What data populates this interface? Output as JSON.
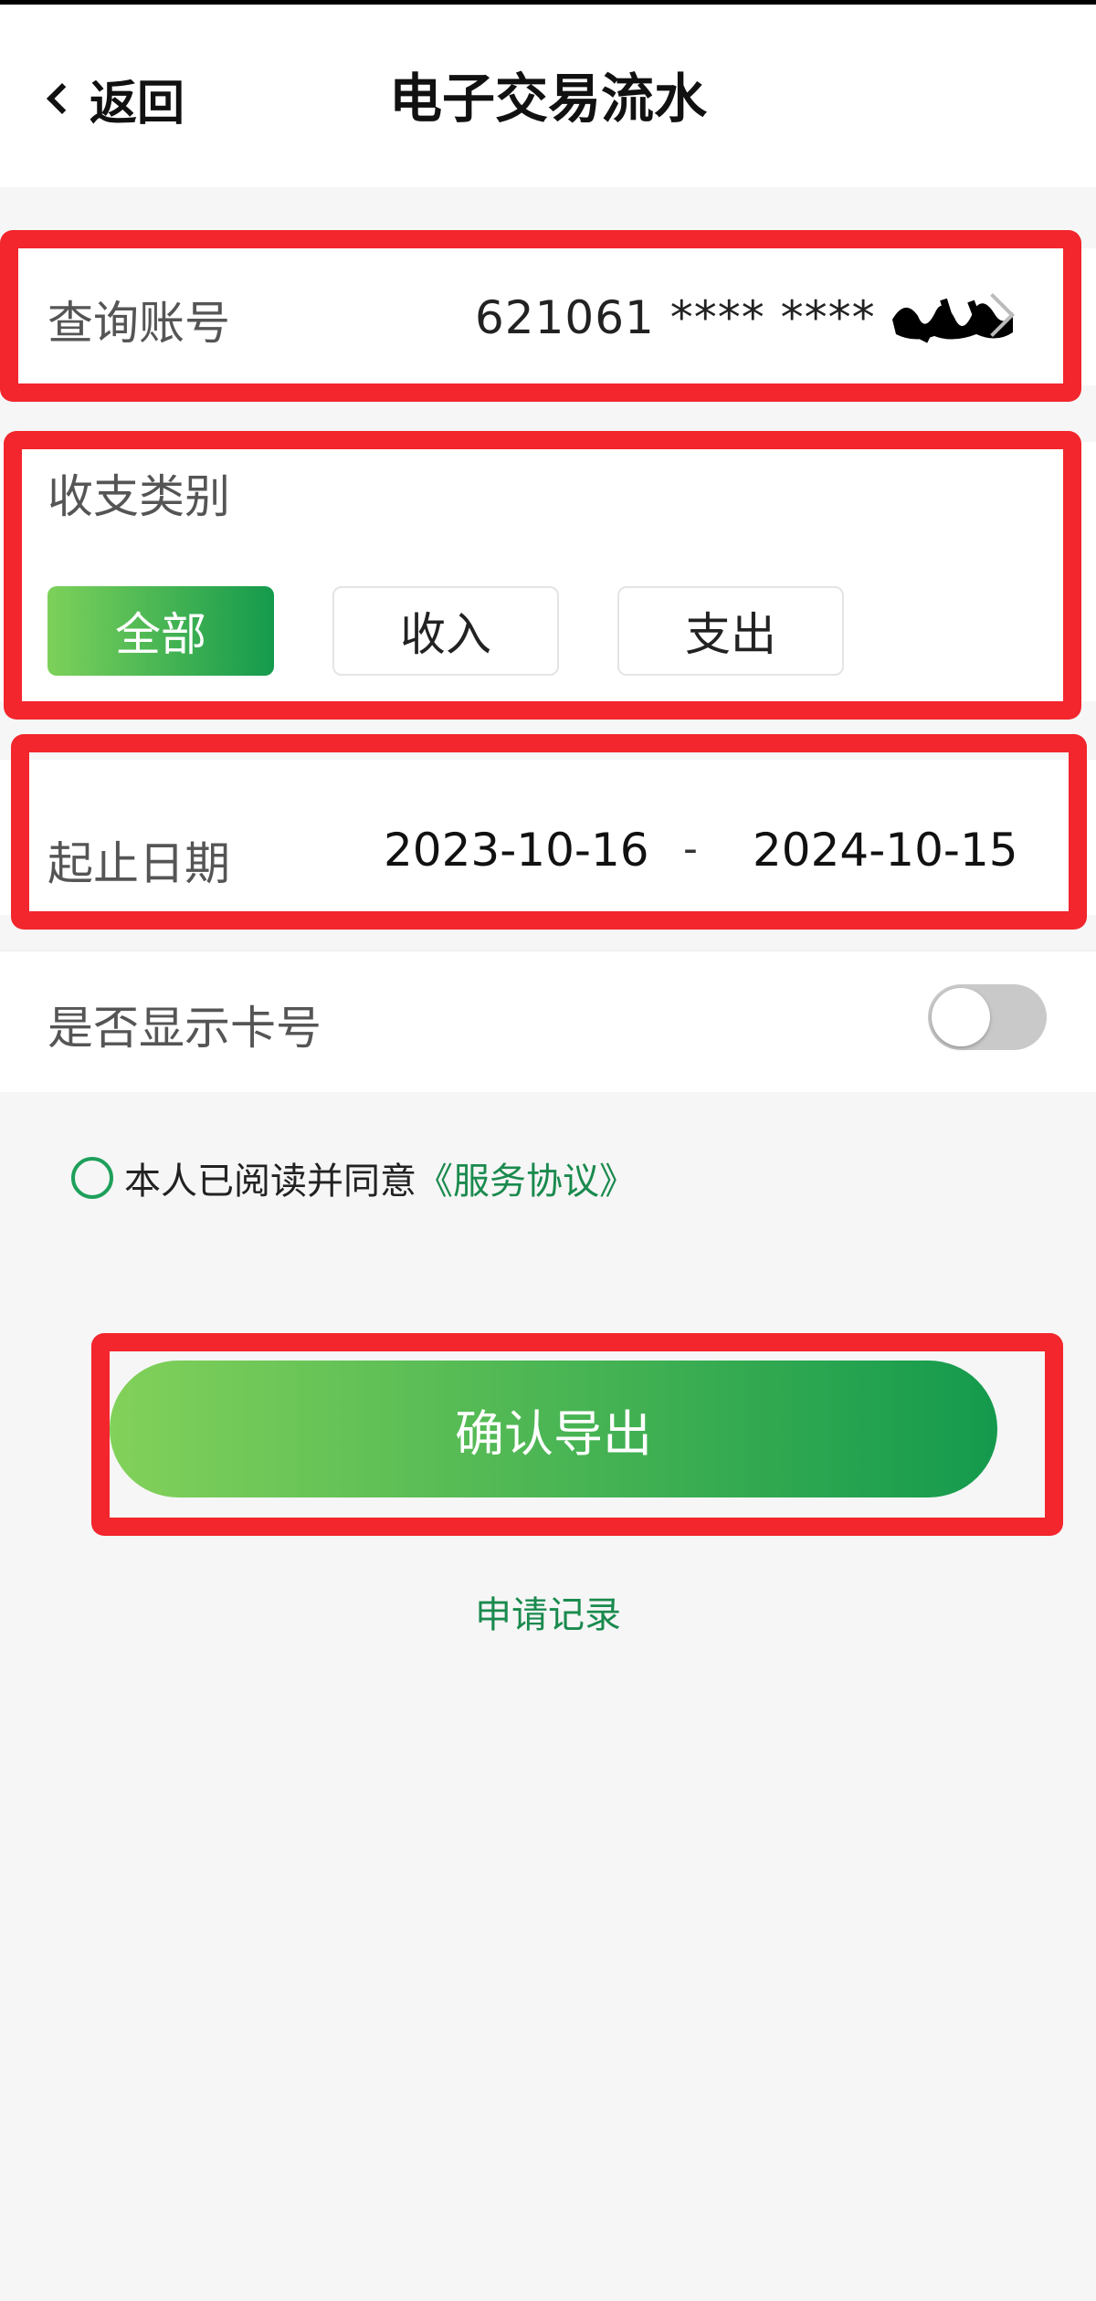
{
  "header": {
    "back_label": "返回",
    "title": "电子交易流水"
  },
  "account": {
    "label": "查询账号",
    "number_masked": "621061 **** ****"
  },
  "type": {
    "label": "收支类别",
    "options": [
      "全部",
      "收入",
      "支出"
    ],
    "selected": "全部"
  },
  "dates": {
    "label": "起止日期",
    "start": "2023-10-16",
    "separator": "-",
    "end": "2024-10-15"
  },
  "show_card": {
    "label": "是否显示卡号",
    "enabled": false
  },
  "agreement": {
    "text": "本人已阅读并同意",
    "link": "《服务协议》",
    "checked": false
  },
  "confirm_label": "确认导出",
  "records_link": "申请记录",
  "colors": {
    "accent_start": "#7dd15a",
    "accent_end": "#149a4d",
    "highlight": "#f2262c",
    "link": "#1a8a4e"
  }
}
